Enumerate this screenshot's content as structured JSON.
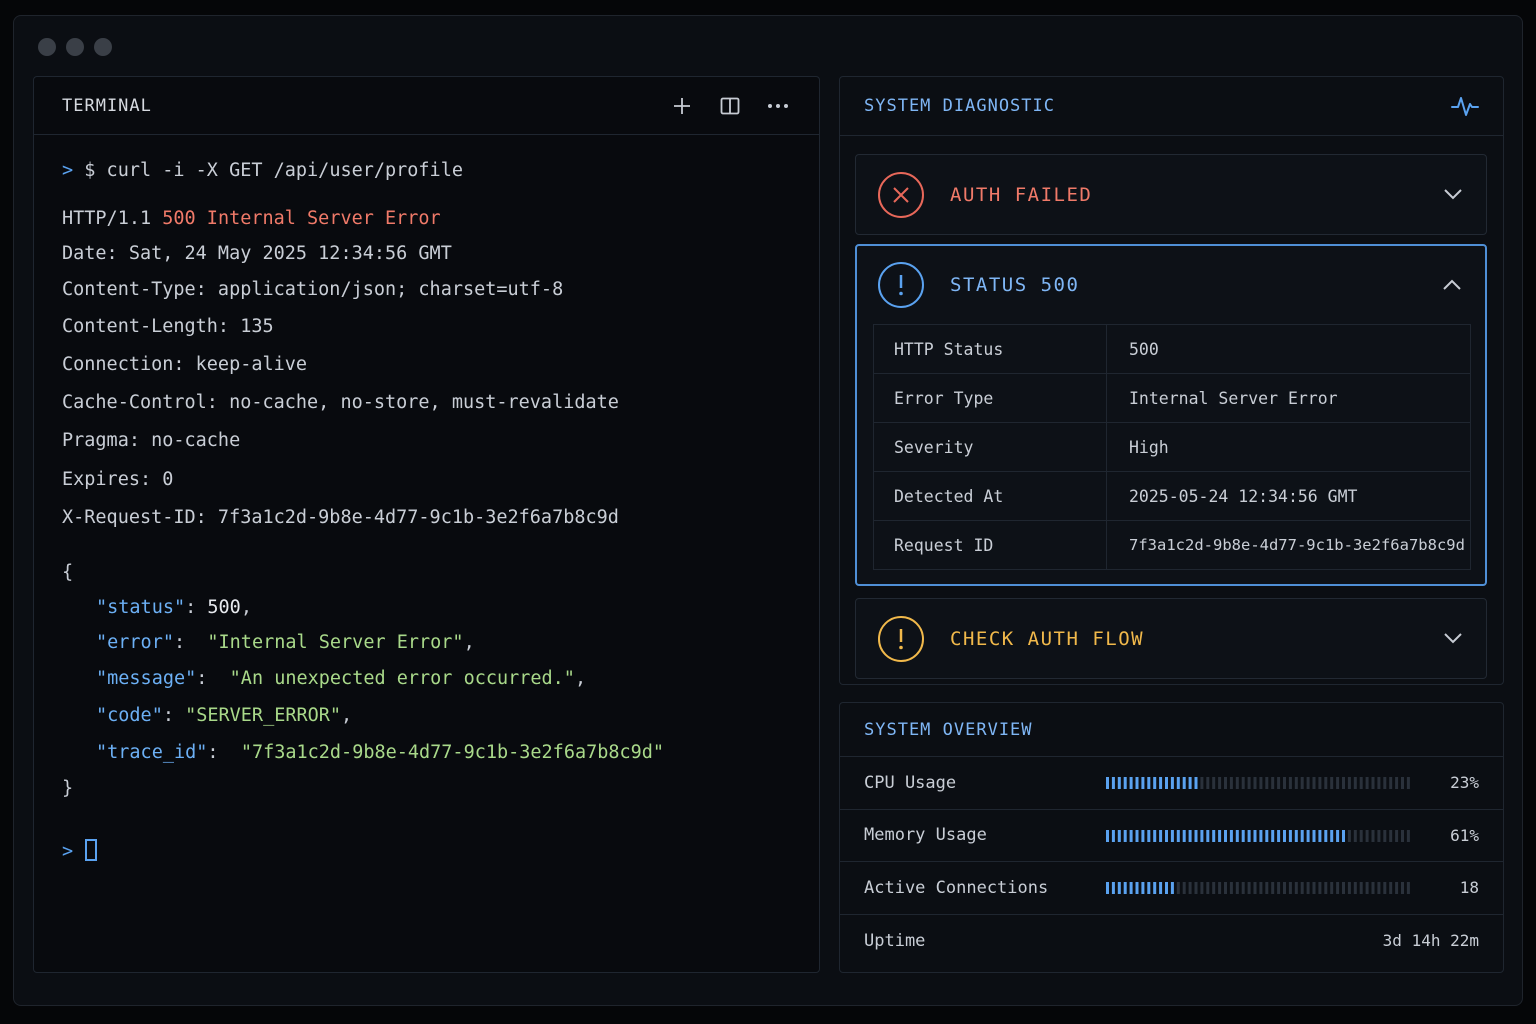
{
  "terminal": {
    "title": "TERMINAL",
    "command": "$ curl -i -X GET /api/user/profile",
    "status_line_prefix": "HTTP/1.1 ",
    "status_line_error": "500 Internal Server Error",
    "headers": [
      "Date: Sat, 24 May 2025 12:34:56 GMT",
      "Content-Type: application/json; charset=utf-8",
      "Content-Length: 135",
      "Connection: keep-alive",
      "Cache-Control: no-cache, no-store, must-revalidate",
      "Pragma: no-cache",
      "Expires: 0",
      "X-Request-ID: 7f3a1c2d-9b8e-4d77-9c1b-3e2f6a7b8c9d"
    ],
    "json_open": "{",
    "json_close": "}",
    "json_fields": [
      {
        "key": "\"status\"",
        "value": "500",
        "type": "num",
        "trail": ","
      },
      {
        "key": "\"error\"",
        "value": "\"Internal Server Error\"",
        "type": "str",
        "trail": ","
      },
      {
        "key": "\"message\"",
        "value": "\"An unexpected error occurred.\"",
        "type": "str",
        "trail": ","
      },
      {
        "key": "\"code\"",
        "value": "\"SERVER_ERROR\"",
        "type": "str",
        "trail": ","
      },
      {
        "key": "\"trace_id\"",
        "value": "\"7f3a1c2d-9b8e-4d77-9c1b-3e2f6a7b8c9d\"",
        "type": "str",
        "trail": ""
      }
    ],
    "actions": [
      {
        "name": "new-terminal-button",
        "icon": "plus-icon"
      },
      {
        "name": "split-terminal-button",
        "icon": "split-icon"
      },
      {
        "name": "more-options-button",
        "icon": "ellipsis-icon"
      }
    ]
  },
  "diagnostic": {
    "title": "SYSTEM DIAGNOSTIC",
    "cards": {
      "auth": {
        "label": "AUTH FAILED",
        "icon": "x-circle-icon",
        "expanded": false,
        "color": "#e8685a"
      },
      "status": {
        "label": "STATUS 500",
        "icon": "exclamation-circle-icon",
        "expanded": true,
        "color": "#5aa2f0"
      },
      "check": {
        "label": "CHECK AUTH FLOW",
        "icon": "warning-circle-icon",
        "expanded": false,
        "color": "#f1b94b"
      }
    },
    "details": [
      {
        "key": "HTTP Status",
        "value": "500",
        "highlight": true
      },
      {
        "key": "Error Type",
        "value": "Internal Server Error",
        "highlight": false
      },
      {
        "key": "Severity",
        "value": "High",
        "highlight": true
      },
      {
        "key": "Detected At",
        "value": "2025-05-24 12:34:56 GMT",
        "highlight": false
      },
      {
        "key": "Request ID",
        "value": "7f3a1c2d-9b8e-4d77-9c1b-3e2f6a7b8c9d",
        "highlight": false
      }
    ]
  },
  "overview": {
    "title": "SYSTEM OVERVIEW",
    "rows": [
      {
        "label": "CPU Usage",
        "value": "23%",
        "fraction": 0.23
      },
      {
        "label": "Memory Usage",
        "value": "61%",
        "fraction": 0.61
      },
      {
        "label": "Active Connections",
        "value": "18",
        "fraction": 0.18
      },
      {
        "label": "Uptime",
        "value": "3d 14h 22m"
      }
    ]
  },
  "colors": {
    "accent": "#5aa2f0",
    "error": "#f07a69",
    "warning": "#f1b94b",
    "json_key": "#6cb0f5",
    "json_string": "#a9d98a"
  }
}
